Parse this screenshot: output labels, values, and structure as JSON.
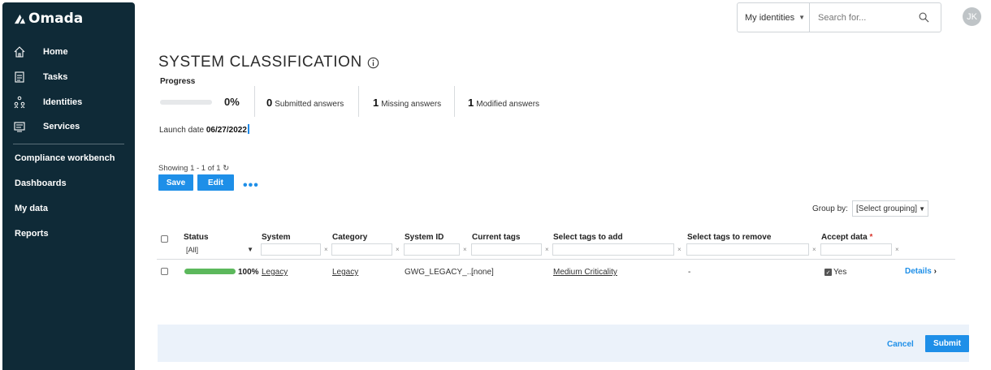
{
  "sidebar": {
    "logo": "Omada",
    "items": [
      {
        "label": "Home",
        "icon": "home-icon"
      },
      {
        "label": "Tasks",
        "icon": "tasks-icon"
      },
      {
        "label": "Identities",
        "icon": "identities-icon"
      },
      {
        "label": "Services",
        "icon": "services-icon"
      }
    ],
    "sections": [
      "Compliance workbench",
      "Dashboards",
      "My data",
      "Reports"
    ]
  },
  "topbar": {
    "identity_scope": "My identities",
    "search_placeholder": "Search for...",
    "avatar_initials": "JK"
  },
  "page": {
    "title": "SYSTEM CLASSIFICATION",
    "progress_label": "Progress",
    "progress_percent": "0%",
    "progress_value": 0,
    "stats": [
      {
        "count": "0",
        "label": "Submitted answers"
      },
      {
        "count": "1",
        "label": "Missing answers"
      },
      {
        "count": "1",
        "label": "Modified answers"
      }
    ],
    "launch_label": "Launch date",
    "launch_date": "06/27/2022"
  },
  "toolbar": {
    "showing": "Showing 1 - 1 of 1",
    "refresh_glyph": "↻",
    "save_label": "Save",
    "edit_label": "Edit",
    "more_label": "•••"
  },
  "grouping": {
    "label": "Group by:",
    "selected": "[Select grouping]"
  },
  "table": {
    "columns": [
      "Status",
      "System",
      "Category",
      "System ID",
      "Current tags",
      "Select tags to add",
      "Select tags to remove",
      "Accept data"
    ],
    "status_filter": "[All]",
    "rows": [
      {
        "progress": "100%",
        "progress_value": 100,
        "system": "Legacy",
        "category": "Legacy",
        "system_id": "GWG_LEGACY_...",
        "current_tags": "[none]",
        "tags_to_add": "Medium Criticality",
        "tags_to_remove": "-",
        "accept": "Yes",
        "details": "Details"
      }
    ]
  },
  "footer": {
    "cancel_label": "Cancel",
    "submit_label": "Submit"
  },
  "colors": {
    "sidebar_bg": "#0f2a37",
    "accent": "#1e8fe8",
    "progress_complete": "#5cb85c",
    "footer_bg": "#ebf2fa"
  }
}
